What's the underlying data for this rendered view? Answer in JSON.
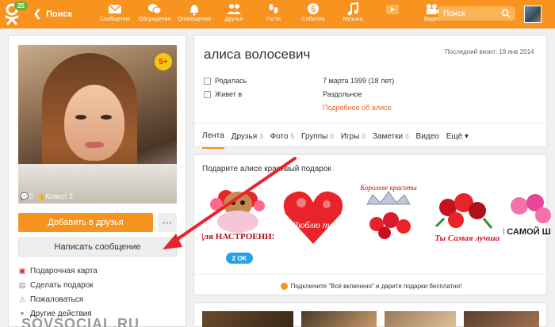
{
  "topbar": {
    "logo_badge": "25",
    "search_back": "Поиск",
    "nav": [
      {
        "label": "Сообщения",
        "icon": "envelope-icon"
      },
      {
        "label": "Обсуждения",
        "icon": "chat-icon"
      },
      {
        "label": "Оповещения",
        "icon": "bell-icon"
      },
      {
        "label": "Друзья",
        "icon": "friends-icon"
      },
      {
        "label": "Гости",
        "icon": "footprints-icon"
      },
      {
        "label": "События",
        "icon": "events-icon"
      },
      {
        "label": "Музыка",
        "icon": "music-icon"
      },
      {
        "label": "",
        "icon": "video-play-icon"
      },
      {
        "label": "Видео",
        "icon": "camera-icon"
      }
    ],
    "search_placeholder": "Поиск"
  },
  "profile": {
    "age_badge": "5+",
    "photo_comments": "0",
    "photo_likes": "Класс! 2",
    "add_friend": "Добавить в друзья",
    "more": "···",
    "write_message": "Написать сообщение",
    "links": [
      "Подарочная карта",
      "Сделать подарок",
      "Пожаловаться",
      "Другие действия"
    ],
    "watermark": "SOVSOCIAL.RU"
  },
  "main": {
    "name": "алиса волосевич",
    "last_visit": "Последний визит: 19 янв 2014",
    "born_label": "Родилась",
    "born_value": "7 марта 1999 (18 лет)",
    "lives_label": "Живет в",
    "lives_value": "Раздольное",
    "more_about": "Подробнее об алисе",
    "tabs": [
      {
        "label": "Лента",
        "count": ""
      },
      {
        "label": "Друзья",
        "count": "3"
      },
      {
        "label": "Фото",
        "count": "5"
      },
      {
        "label": "Группы",
        "count": "0"
      },
      {
        "label": "Игры",
        "count": "0"
      },
      {
        "label": "Заметки",
        "count": "0"
      },
      {
        "label": "Видео",
        "count": ""
      },
      {
        "label": "Ещё ▾",
        "count": ""
      }
    ]
  },
  "gifts": {
    "title": "Подарите алисе красивый подарок",
    "items": [
      {
        "text": "Для НАСТРОЕНИЯ"
      },
      {
        "text": "Люблю тебя"
      },
      {
        "text": "Королеве красоты"
      },
      {
        "text": "Ты Самая лучшая"
      },
      {
        "text": "ДЛЯ САМОЙ ШИКА"
      }
    ],
    "price": "2 OK",
    "promo": "Подключите \"Всё включено\" и дарите подарки бесплатно!"
  },
  "colors": {
    "brand": "#f7931e",
    "link": "#e8672b",
    "price_badge": "#27a1e3",
    "annotation_arrow": "#e8242a"
  }
}
